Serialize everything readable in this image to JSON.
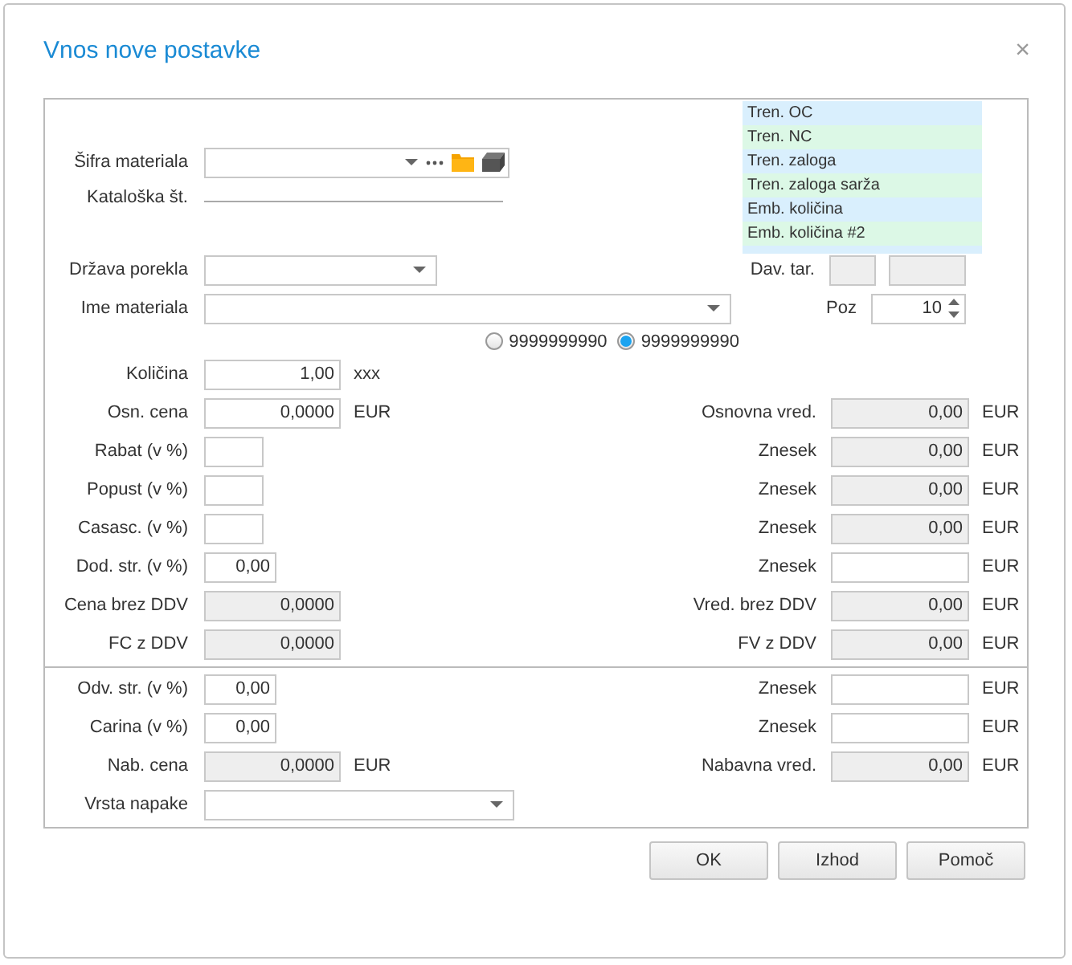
{
  "window": {
    "title": "Vnos nove postavke",
    "close": "×"
  },
  "material_code": {
    "label": "Šifra materiala"
  },
  "catalog_no": {
    "label": "Kataloška št."
  },
  "info_list": [
    {
      "label": "Tren. OC",
      "color": "#d9effd"
    },
    {
      "label": "Tren. NC",
      "color": "#dcf8e6"
    },
    {
      "label": "Tren. zaloga",
      "color": "#d9effd"
    },
    {
      "label": "Tren. zaloga sarža",
      "color": "#dcf8e6"
    },
    {
      "label": "Emb. količina",
      "color": "#d9effd"
    },
    {
      "label": "Emb. količina #2",
      "color": "#dcf8e6"
    }
  ],
  "rows": [
    {
      "kind": "fields",
      "label": "Država porekla",
      "fields": [
        {
          "kind": "select",
          "disabled": false
        }
      ],
      "right": {
        "label": "Dav. tar.",
        "fields": [
          {
            "kind": "text",
            "disabled": true
          },
          {
            "kind": "text",
            "disabled": true
          }
        ]
      }
    },
    {
      "kind": "fields",
      "label": "Ime materiala",
      "fields": [
        {
          "kind": "select",
          "disabled": false
        }
      ],
      "right": {
        "label": "Poz",
        "fields": [
          {
            "kind": "spinner",
            "disabled": false,
            "value": "10"
          }
        ]
      }
    },
    {
      "kind": "radios",
      "options": [
        {
          "label": "9999999990",
          "selected": false
        },
        {
          "label": "9999999990",
          "selected": true
        }
      ]
    },
    {
      "kind": "fields",
      "label": "Količina",
      "fields": [
        {
          "kind": "text",
          "disabled": false,
          "value": "1,00"
        }
      ],
      "unit": "xxx"
    },
    {
      "kind": "fields",
      "label": "Osn. cena",
      "fields": [
        {
          "kind": "text",
          "disabled": false,
          "value": "0,0000"
        }
      ],
      "unit": "EUR",
      "right": {
        "label": "Osnovna vred.",
        "fields": [
          {
            "kind": "text",
            "disabled": true,
            "value": "0,00"
          }
        ],
        "unit": "EUR"
      }
    },
    {
      "kind": "fields",
      "label": "Rabat (v %)",
      "fields": [
        {
          "kind": "text",
          "disabled": false
        }
      ],
      "right": {
        "label": "Znesek",
        "fields": [
          {
            "kind": "text",
            "disabled": true,
            "value": "0,00"
          }
        ],
        "unit": "EUR"
      }
    },
    {
      "kind": "fields",
      "label": "Popust (v %)",
      "fields": [
        {
          "kind": "text",
          "disabled": false
        }
      ],
      "right": {
        "label": "Znesek",
        "fields": [
          {
            "kind": "text",
            "disabled": true,
            "value": "0,00"
          }
        ],
        "unit": "EUR"
      }
    },
    {
      "kind": "fields",
      "label": "Casasc. (v %)",
      "fields": [
        {
          "kind": "text",
          "disabled": false
        }
      ],
      "right": {
        "label": "Znesek",
        "fields": [
          {
            "kind": "text",
            "disabled": true,
            "value": "0,00"
          }
        ],
        "unit": "EUR"
      }
    },
    {
      "kind": "fields",
      "label": "Dod. str. (v %)",
      "fields": [
        {
          "kind": "text",
          "disabled": false,
          "value": "0,00"
        }
      ],
      "right": {
        "label": "Znesek",
        "fields": [
          {
            "kind": "text",
            "disabled": false
          }
        ],
        "unit": "EUR"
      }
    },
    {
      "kind": "fields",
      "label": "Cena brez DDV",
      "fields": [
        {
          "kind": "text",
          "disabled": true,
          "value": "0,0000"
        }
      ],
      "right": {
        "label": "Vred. brez DDV",
        "fields": [
          {
            "kind": "text",
            "disabled": true,
            "value": "0,00"
          }
        ],
        "unit": "EUR"
      }
    },
    {
      "kind": "fields",
      "label": "FC z DDV",
      "fields": [
        {
          "kind": "text",
          "disabled": true,
          "value": "0,0000"
        }
      ],
      "right": {
        "label": "FV z DDV",
        "fields": [
          {
            "kind": "text",
            "disabled": true,
            "value": "0,00"
          }
        ],
        "unit": "EUR"
      }
    },
    {
      "kind": "divider"
    },
    {
      "kind": "fields",
      "label": "Odv. str. (v %)",
      "fields": [
        {
          "kind": "text",
          "disabled": false,
          "value": "0,00"
        }
      ],
      "right": {
        "label": "Znesek",
        "fields": [
          {
            "kind": "text",
            "disabled": false
          }
        ],
        "unit": "EUR"
      }
    },
    {
      "kind": "fields",
      "label": "Carina (v %)",
      "fields": [
        {
          "kind": "text",
          "disabled": false,
          "value": "0,00"
        }
      ],
      "right": {
        "label": "Znesek",
        "fields": [
          {
            "kind": "text",
            "disabled": false
          }
        ],
        "unit": "EUR"
      }
    },
    {
      "kind": "fields",
      "label": "Nab. cena",
      "fields": [
        {
          "kind": "text",
          "disabled": true,
          "value": "0,0000"
        }
      ],
      "unit": "EUR",
      "right": {
        "label": "Nabavna vred.",
        "fields": [
          {
            "kind": "text",
            "disabled": true,
            "value": "0,00"
          }
        ],
        "unit": "EUR"
      }
    },
    {
      "kind": "fields",
      "label": "Vrsta napake",
      "fields": [
        {
          "kind": "select",
          "disabled": false
        }
      ]
    }
  ],
  "buttons": [
    {
      "label": "OK"
    },
    {
      "label": "Izhod"
    },
    {
      "label": "Pomoč"
    }
  ]
}
